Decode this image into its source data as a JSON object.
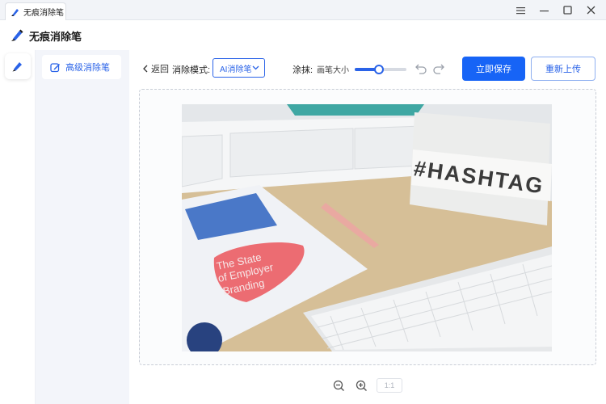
{
  "window": {
    "tab_title": "无痕消除笔",
    "app_title": "无痕消除笔"
  },
  "sidemenu": {
    "items": [
      {
        "label": "高级消除笔",
        "icon": "edit-icon",
        "active": true
      }
    ]
  },
  "toolbar": {
    "back_label": "返回",
    "mode_label": "消除模式:",
    "mode_value": "AI消除笔",
    "brush_label": "涂抹:",
    "brush_size_label": "画笔大小",
    "brush_size_fraction": 0.47,
    "save_label": "立即保存",
    "reupload_label": "重新上传"
  },
  "photo": {
    "lightbox_text": "#HASHTAG",
    "booklet_text": [
      "The State",
      "of Employer",
      "Branding"
    ]
  },
  "zoom": {
    "ratio_label": "1:1"
  },
  "colors": {
    "accent": "#1764f6",
    "menu_bg": "#f3f5fa"
  }
}
